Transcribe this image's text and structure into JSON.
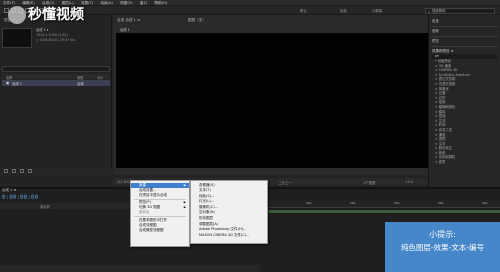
{
  "menubar": {
    "items": [
      "文件(F)",
      "编辑(E)",
      "合成(C)",
      "图层(L)",
      "效果(T)",
      "动画(A)",
      "视图(V)",
      "窗口",
      "帮助(H)"
    ]
  },
  "toolbar": {
    "workspaces": [
      "默认",
      "标准",
      "小屏幕"
    ],
    "search_placeholder": "搜索帮助"
  },
  "watermark": {
    "text": "秒懂视频"
  },
  "project": {
    "tab": "项目 ≡",
    "comp_name": "合成 1 ▾",
    "comp_size": "1920 x 1080 (1.00)",
    "comp_duration": "△ 0;00;30;00, 29.97 fps",
    "columns": [
      "名称",
      "类型",
      "大小"
    ],
    "row_name": "合成 1",
    "row_type": "合成"
  },
  "viewer": {
    "tab": "合成 合成 1 ≡",
    "sub_tab": "合成 1",
    "layer_tab": "图层（无）",
    "footer_zoom": "(22.8%)",
    "footer_time": "0;00;00;00",
    "footer_res": "二分之一",
    "footer_view": "1个视图",
    "footer_offset": "+0.0"
  },
  "right_panel": {
    "items": [
      "信息",
      "音频",
      "预览"
    ],
    "effects_header": "效果和预设 ≡",
    "search": "ρ▾",
    "effects": [
      "* 动画预设",
      "> 3D 通道",
      "> CINEMA 4D",
      "> Synthetic Aperture",
      "> 表达式控制",
      "> 沉浸式视频",
      "> 风格化",
      "> 过渡",
      "> 过时",
      "> 抠像",
      "> 模糊和锐化",
      "> 模拟",
      "> 扭曲",
      "> 生成",
      "> 时间",
      "> 实用工具",
      "> 通道",
      "> 透视",
      "> 文本",
      "> 颜色校正",
      "> 音频",
      "> 杂色和颗粒",
      "> 遮罩"
    ]
  },
  "timeline": {
    "tab": "合成 1 ≡",
    "timecode": "0:00:00:00",
    "col_source": "源名称",
    "col_parent": "父级",
    "ruler": [
      "0s",
      "05s",
      "10s",
      "15s",
      "20s",
      "25s"
    ]
  },
  "context_menu": {
    "items": [
      {
        "label": "新建",
        "highlight": true,
        "arrow": true
      },
      {
        "label": "合成设置..."
      },
      {
        "label": "在项目中显示合成"
      },
      {
        "sep": true
      },
      {
        "label": "预览(P)",
        "arrow": true
      },
      {
        "label": "切换 3D 视图",
        "arrow": true
      },
      {
        "label": "重命名",
        "dim": true
      },
      {
        "sep": true
      },
      {
        "label": "在基本图形中打开"
      },
      {
        "label": "合成流程图"
      },
      {
        "label": "合成微型流程图"
      }
    ]
  },
  "sub_menu": {
    "items": [
      "查看器(V)",
      "文本(T)",
      "纯色(S)...",
      "灯光(L)...",
      "摄像机(C)...",
      "空对象(N)",
      "形状图层",
      "调整图层(A)",
      "Adobe Photoshop 文件(H)...",
      "MAXON CINEMA 4D 文件(C)..."
    ]
  },
  "tip": {
    "title": "小提示:",
    "text": "纯色图层-效果-文本-编号"
  }
}
